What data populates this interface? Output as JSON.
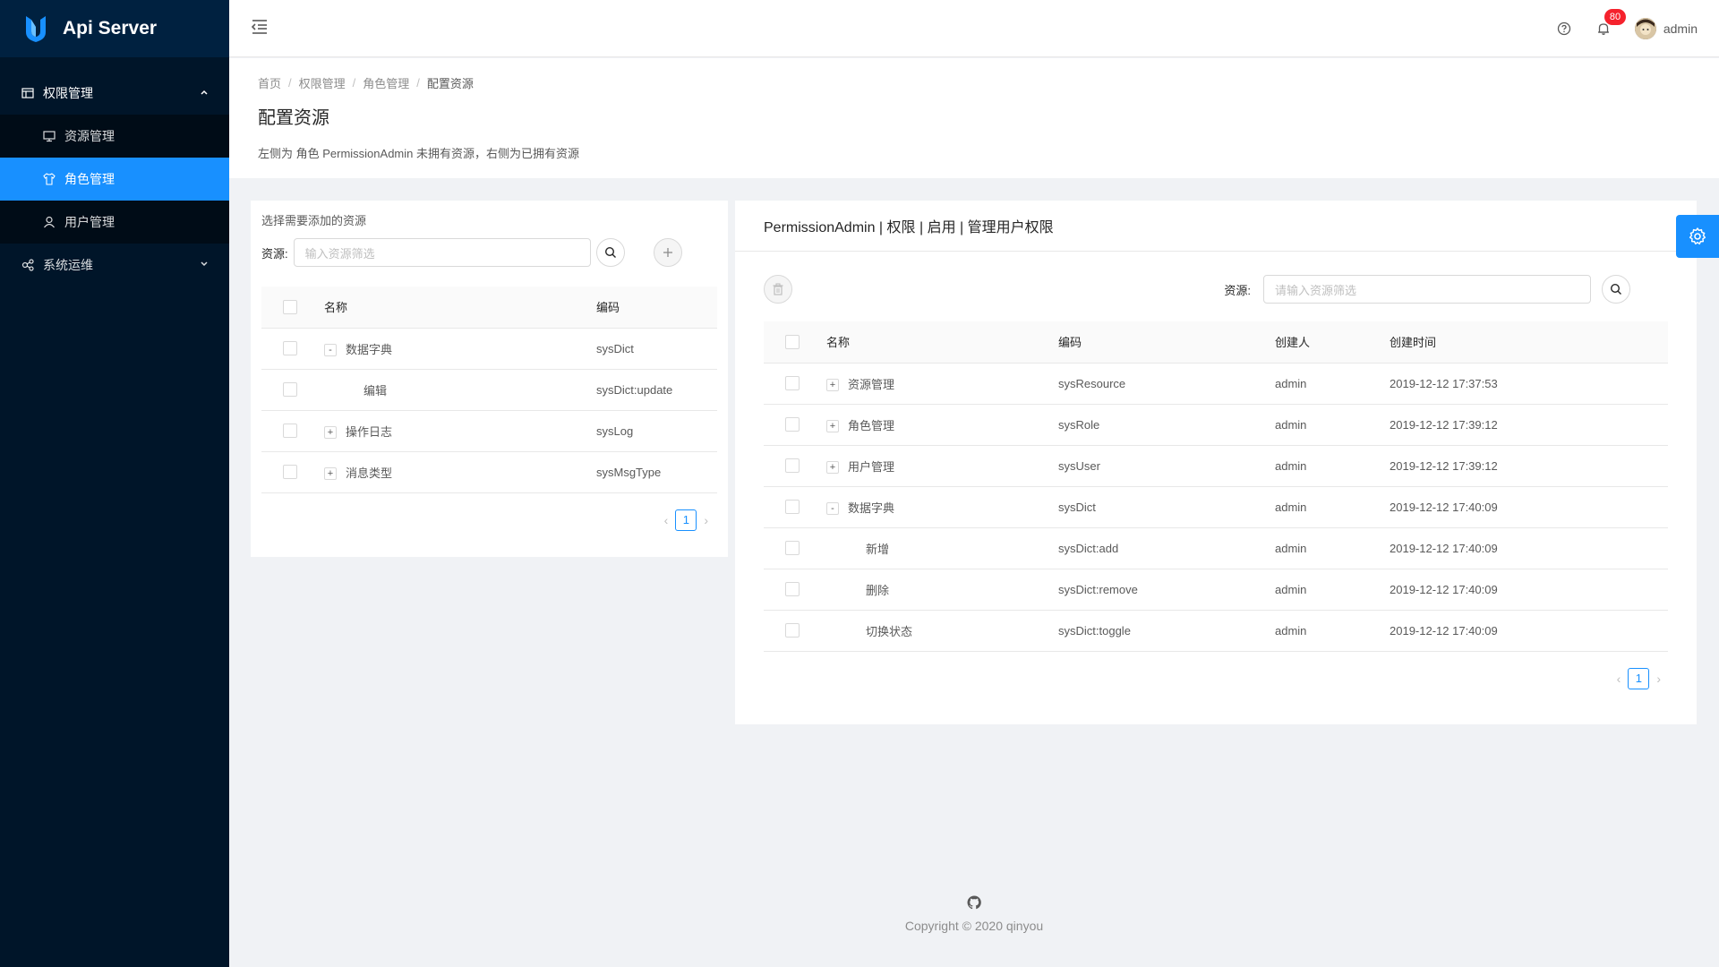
{
  "app": {
    "title": "Api Server"
  },
  "sidebar": {
    "groups": [
      {
        "label": "权限管理",
        "expanded": true,
        "items": [
          {
            "label": "资源管理",
            "active": false
          },
          {
            "label": "角色管理",
            "active": true
          },
          {
            "label": "用户管理",
            "active": false
          }
        ]
      },
      {
        "label": "系统运维",
        "expanded": false
      }
    ]
  },
  "header": {
    "notification_count": "80",
    "username": "admin"
  },
  "breadcrumb": [
    "首页",
    "权限管理",
    "角色管理",
    "配置资源"
  ],
  "page": {
    "title": "配置资源",
    "description": "左侧为 角色 PermissionAdmin 未拥有资源，右侧为已拥有资源"
  },
  "left_panel": {
    "title": "选择需要添加的资源",
    "filter_label": "资源:",
    "filter_placeholder": "输入资源筛选",
    "columns": [
      "名称",
      "编码"
    ],
    "rows": [
      {
        "expander": "-",
        "name": "数据字典",
        "code": "sysDict",
        "indent": false
      },
      {
        "expander": "",
        "name": "编辑",
        "code": "sysDict:update",
        "indent": true
      },
      {
        "expander": "+",
        "name": "操作日志",
        "code": "sysLog",
        "indent": false
      },
      {
        "expander": "+",
        "name": "消息类型",
        "code": "sysMsgType",
        "indent": false
      }
    ],
    "page": "1"
  },
  "right_panel": {
    "title": "PermissionAdmin | 权限 | 启用 | 管理用户权限",
    "filter_label": "资源:",
    "filter_placeholder": "请输入资源筛选",
    "columns": [
      "名称",
      "编码",
      "创建人",
      "创建时间"
    ],
    "rows": [
      {
        "expander": "+",
        "name": "资源管理",
        "code": "sysResource",
        "creator": "admin",
        "time": "2019-12-12 17:37:53",
        "indent": false
      },
      {
        "expander": "+",
        "name": "角色管理",
        "code": "sysRole",
        "creator": "admin",
        "time": "2019-12-12 17:39:12",
        "indent": false
      },
      {
        "expander": "+",
        "name": "用户管理",
        "code": "sysUser",
        "creator": "admin",
        "time": "2019-12-12 17:39:12",
        "indent": false
      },
      {
        "expander": "-",
        "name": "数据字典",
        "code": "sysDict",
        "creator": "admin",
        "time": "2019-12-12 17:40:09",
        "indent": false
      },
      {
        "expander": "",
        "name": "新增",
        "code": "sysDict:add",
        "creator": "admin",
        "time": "2019-12-12 17:40:09",
        "indent": true
      },
      {
        "expander": "",
        "name": "删除",
        "code": "sysDict:remove",
        "creator": "admin",
        "time": "2019-12-12 17:40:09",
        "indent": true
      },
      {
        "expander": "",
        "name": "切换状态",
        "code": "sysDict:toggle",
        "creator": "admin",
        "time": "2019-12-12 17:40:09",
        "indent": true
      }
    ],
    "page": "1"
  },
  "footer": {
    "copyright": "Copyright © 2020 qinyou"
  },
  "colors": {
    "sidebar_bg": "#001529",
    "accent": "#1890ff",
    "badge": "#f5222d"
  }
}
